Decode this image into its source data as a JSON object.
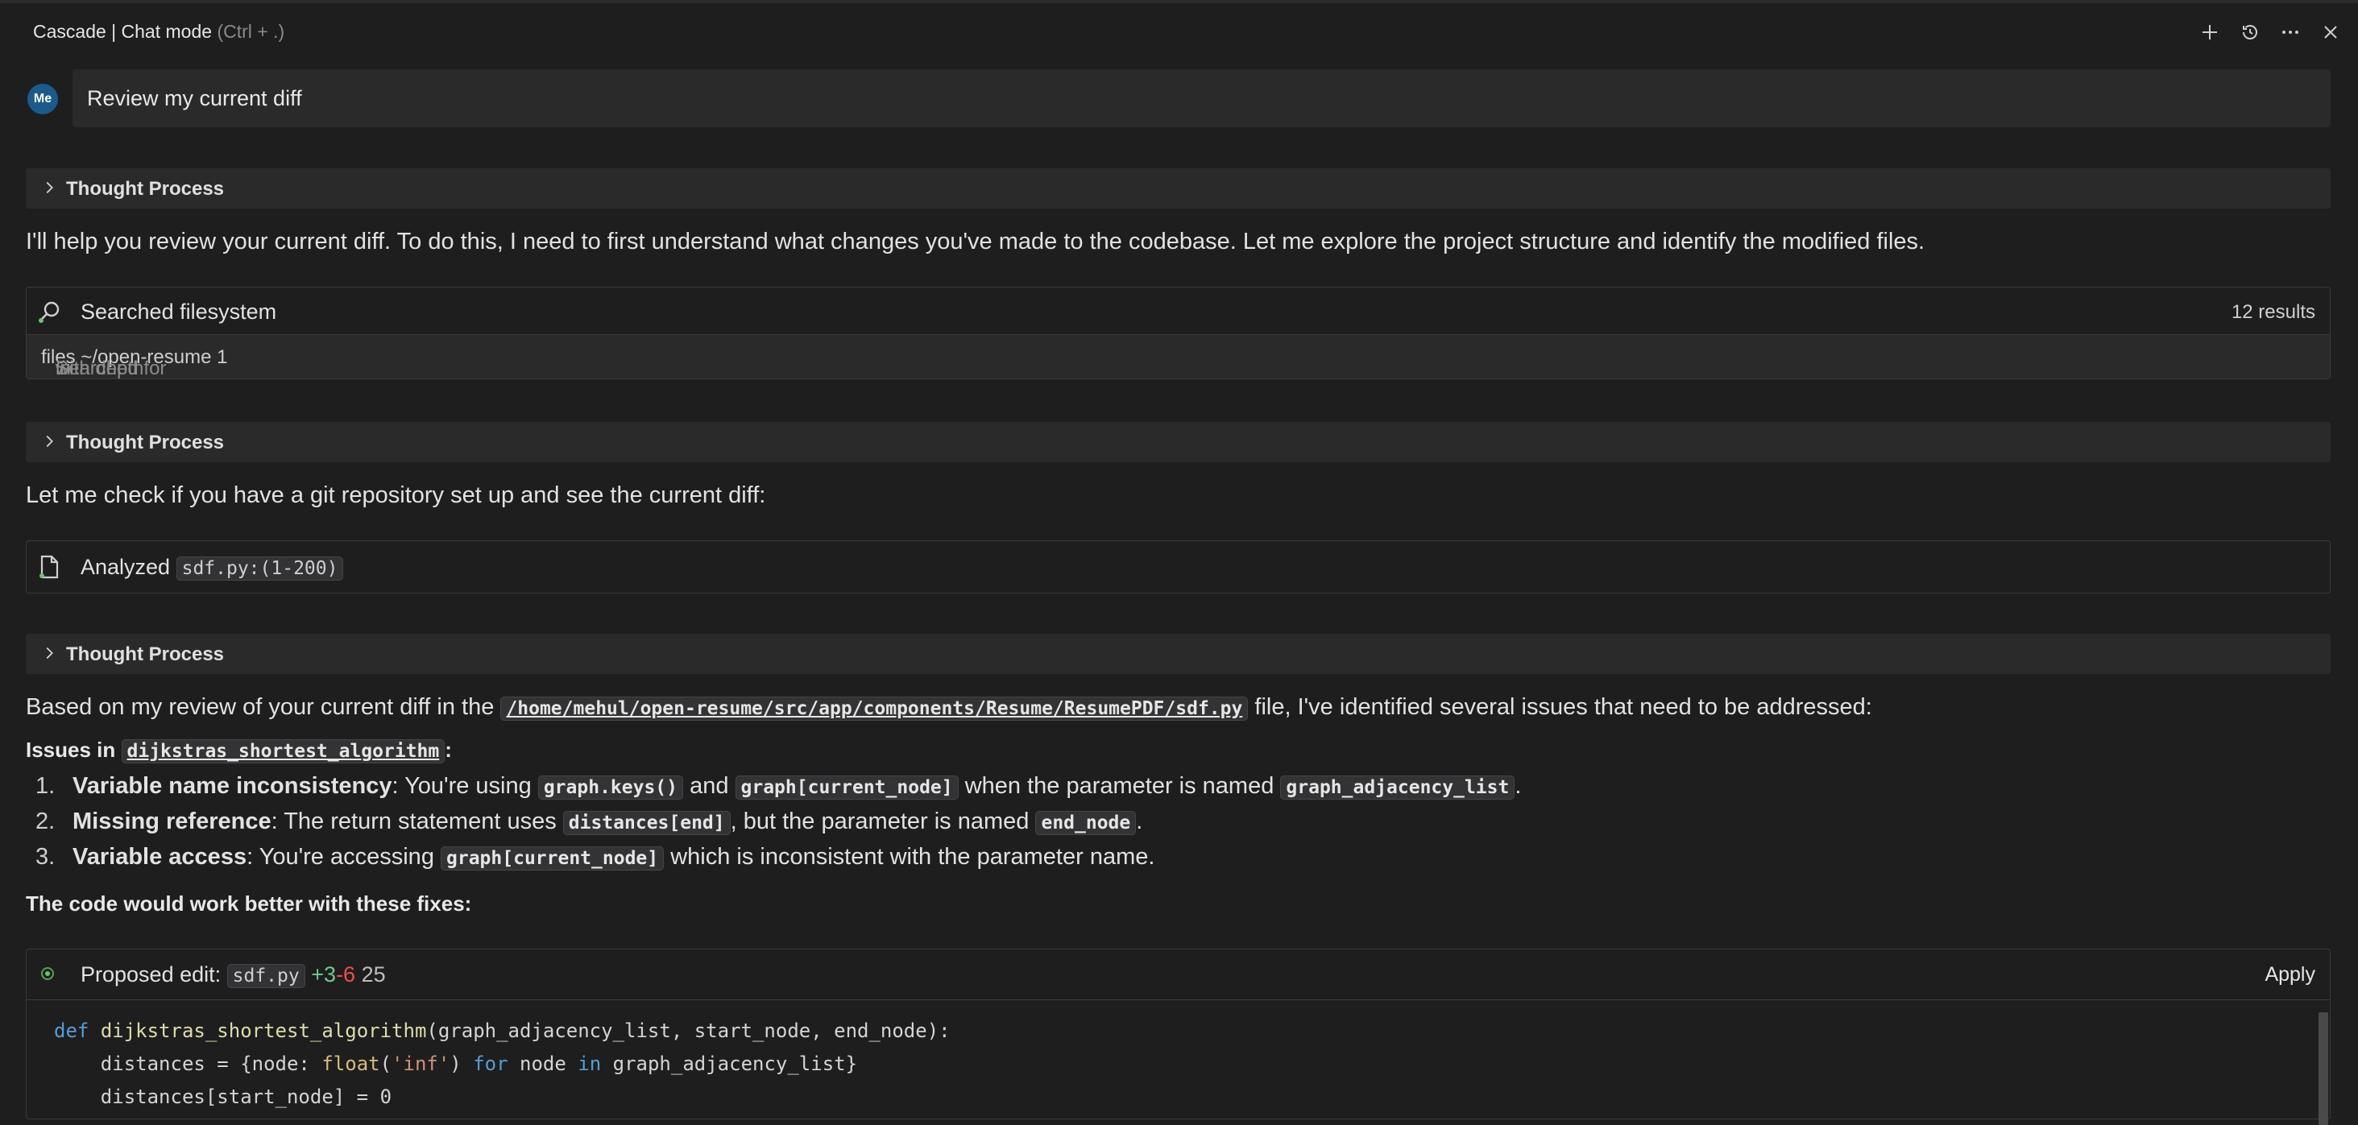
{
  "header": {
    "title": "Cascade | Chat mode",
    "shortcut_hint": "(Ctrl + .)"
  },
  "user": {
    "avatar_text": "Me",
    "message": "Review my current diff"
  },
  "thought_label": "Thought Process",
  "messages": {
    "intro": "I'll help you review your current diff. To do this, I need to first understand what changes you've made to the codebase. Let me explore the project structure and identify the modified files.",
    "git_check": "Let me check if you have a git repository set up and see the current diff:",
    "review_prefix": "Based on my review of your current diff in the",
    "review_path": "/home/mehul/open-resume/src/app/components/Resume/ResumePDF/sdf.py",
    "review_suffix": "file, I've identified several issues that need to be addressed:"
  },
  "search_tool": {
    "label": "Searched filesystem",
    "results": "12 results",
    "sub_prefix": "Searched for",
    "sub_files": "files",
    "sub_in": "in",
    "sub_path": "~/open-resume",
    "sub_with": "with depth",
    "sub_depth": "1"
  },
  "analyze_tool": {
    "label": "Analyzed",
    "file": "sdf.py:(1-200)"
  },
  "issues": {
    "heading_prefix": "Issues in",
    "heading_code": "dijkstras_shortest_algorithm",
    "heading_suffix": ":",
    "items": [
      {
        "num": "1.",
        "title": "Variable name inconsistency",
        "t1": ": You're using",
        "c1": "graph.keys()",
        "t2": "and",
        "c2": "graph[current_node]",
        "t3": "when the parameter is named",
        "c3": "graph_adjacency_list",
        "t4": "."
      },
      {
        "num": "2.",
        "title": "Missing reference",
        "t1": ": The return statement uses",
        "c1": "distances[end]",
        "t2": ", but the parameter is named",
        "c2": "end_node",
        "t3": "."
      },
      {
        "num": "3.",
        "title": "Variable access",
        "t1": ": You're accessing",
        "c1": "graph[current_node]",
        "t2": "which is inconsistent with the parameter name."
      }
    ]
  },
  "fixes_heading": "The code would work better with these fixes:",
  "proposed_edit": {
    "label": "Proposed edit:",
    "file": "sdf.py",
    "added": "+3",
    "removed": "-6",
    "count": "25",
    "apply_label": "Apply",
    "code": {
      "l1_kw": "def",
      "l1_fn": "dijkstras_shortest_algorithm",
      "l1_rest": "(graph_adjacency_list, start_node, end_node):",
      "l2_a": "    distances = {node: ",
      "l2_float": "float",
      "l2_b": "(",
      "l2_str": "'inf'",
      "l2_c": ") ",
      "l2_for": "for",
      "l2_d": " node ",
      "l2_in": "in",
      "l2_e": " graph_adjacency_list}",
      "l3": "    distances[start_node] = 0"
    }
  }
}
